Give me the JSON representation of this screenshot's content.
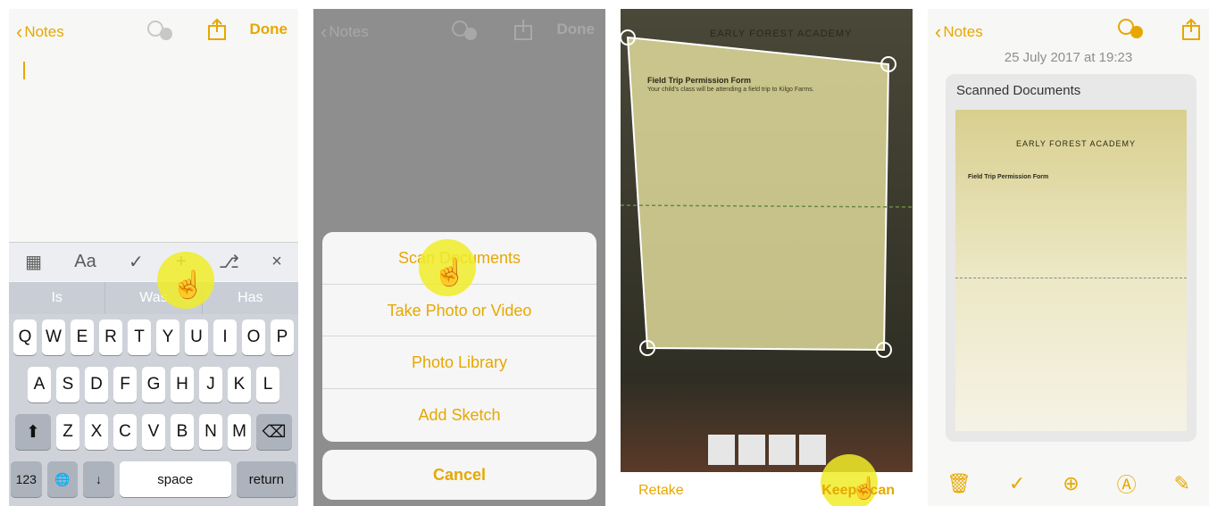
{
  "panel1": {
    "back_label": "Notes",
    "done_label": "Done",
    "toolbar": [
      "▦",
      "Aa",
      "✓",
      "+",
      "⎇",
      "×"
    ],
    "suggestions": [
      "Is",
      "Was",
      "Has"
    ],
    "keys_row1": [
      "Q",
      "W",
      "E",
      "R",
      "T",
      "Y",
      "U",
      "I",
      "O",
      "P"
    ],
    "keys_row2": [
      "A",
      "S",
      "D",
      "F",
      "G",
      "H",
      "J",
      "K",
      "L"
    ],
    "keys_row3": [
      "Z",
      "X",
      "C",
      "V",
      "B",
      "N",
      "M"
    ],
    "key_123": "123",
    "key_space": "space",
    "key_return": "return"
  },
  "panel2": {
    "back_label": "Notes",
    "done_label": "Done",
    "sheet_items": [
      "Scan Documents",
      "Take Photo or Video",
      "Photo Library",
      "Add Sketch"
    ],
    "cancel_label": "Cancel"
  },
  "panel3": {
    "header": "EARLY FOREST ACADEMY",
    "form_title": "Field Trip Permission Form",
    "form_intro": "Your child's class will be attending a field trip to Kilgo Farms.",
    "retake_label": "Retake",
    "keep_label": "Keep Scan"
  },
  "panel4": {
    "back_label": "Notes",
    "timestamp": "25 July 2017 at 19:23",
    "card_title": "Scanned Documents",
    "header": "EARLY FOREST ACADEMY",
    "form_title": "Field Trip Permission Form"
  },
  "colors": {
    "accent": "#e6a800",
    "highlight": "#f0ec28"
  }
}
